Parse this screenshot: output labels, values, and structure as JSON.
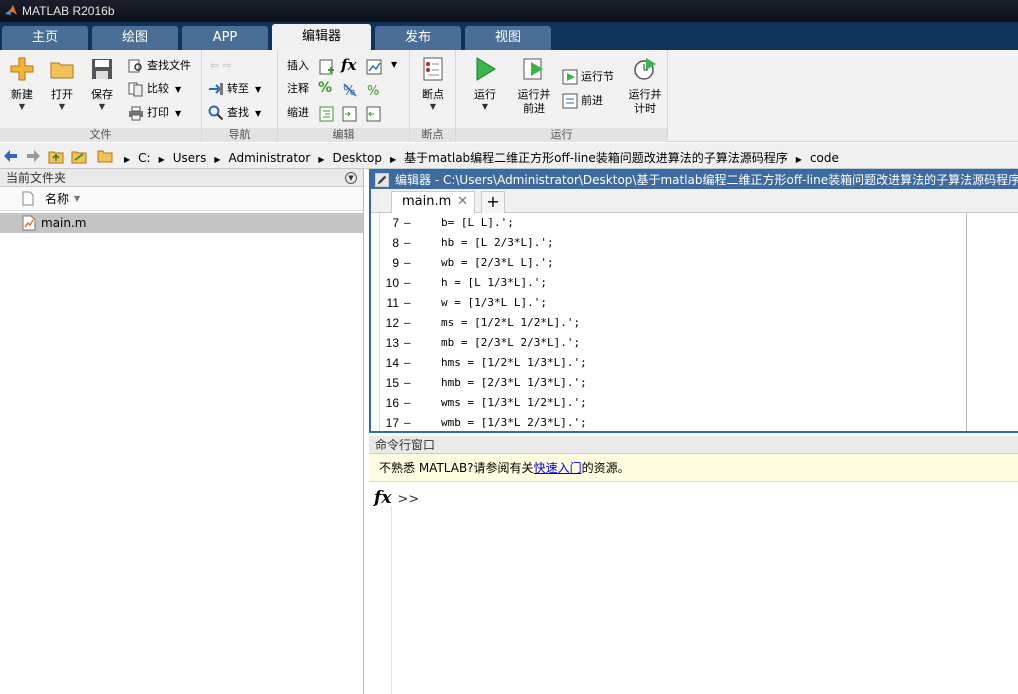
{
  "window": {
    "title": "MATLAB R2016b"
  },
  "tabs": [
    {
      "label": "主页"
    },
    {
      "label": "绘图"
    },
    {
      "label": "APP"
    },
    {
      "label": "编辑器"
    },
    {
      "label": "发布"
    },
    {
      "label": "视图"
    }
  ],
  "ribbon": {
    "file": {
      "title": "文件",
      "new": "新建",
      "open": "打开",
      "save": "保存",
      "find_files": "查找文件",
      "compare": "比较",
      "print": "打印"
    },
    "nav": {
      "title": "导航",
      "goto": "转至",
      "find": "查找"
    },
    "edit": {
      "title": "编辑",
      "insert": "插入",
      "comment": "注释",
      "indent": "缩进"
    },
    "breakpoints": {
      "title": "断点",
      "label": "断点"
    },
    "run": {
      "title": "运行",
      "run": "运行",
      "run_advance_1": "运行并",
      "run_advance_2": "前进",
      "run_section": "运行节",
      "advance": "前进",
      "run_time_1": "运行并",
      "run_time_2": "计时"
    }
  },
  "address": {
    "crumbs": [
      "C:",
      "Users",
      "Administrator",
      "Desktop",
      "基于matlab编程二维正方形off-line装箱问题改进算法的子算法源码程序",
      "code"
    ]
  },
  "file_browser": {
    "title": "当前文件夹",
    "col_name": "名称",
    "files": [
      {
        "name": "main.m"
      }
    ]
  },
  "editor": {
    "title": "编辑器 - C:\\Users\\Administrator\\Desktop\\基于matlab编程二维正方形off-line装箱问题改进算法的子算法源码程序",
    "tab": "main.m",
    "tab_close": "✕",
    "tab_add": "+",
    "lines": [
      {
        "num": "7",
        "mark": "–",
        "code": "b= [L L].';"
      },
      {
        "num": "8",
        "mark": "–",
        "code": "hb = [L 2/3*L].';"
      },
      {
        "num": "9",
        "mark": "–",
        "code": "wb = [2/3*L L].';"
      },
      {
        "num": "10",
        "mark": "–",
        "code": "h = [L 1/3*L].';"
      },
      {
        "num": "11",
        "mark": "–",
        "code": "w = [1/3*L L].';"
      },
      {
        "num": "12",
        "mark": "–",
        "code": "ms = [1/2*L 1/2*L].';"
      },
      {
        "num": "13",
        "mark": "–",
        "code": "mb = [2/3*L 2/3*L].';"
      },
      {
        "num": "14",
        "mark": "–",
        "code": "hms = [1/2*L 1/3*L].';"
      },
      {
        "num": "15",
        "mark": "–",
        "code": "hmb = [2/3*L 1/3*L].';"
      },
      {
        "num": "16",
        "mark": "–",
        "code": "wms = [1/3*L 1/2*L].';"
      },
      {
        "num": "17",
        "mark": "–",
        "code": "wmb = [1/3*L 2/3*L].';"
      }
    ]
  },
  "command_window": {
    "title": "命令行窗口",
    "notice_pre": "不熟悉 MATLAB?请参阅有关",
    "notice_link": "快速入门",
    "notice_post": "的资源。",
    "fx": "fx",
    "prompt": ">>"
  }
}
